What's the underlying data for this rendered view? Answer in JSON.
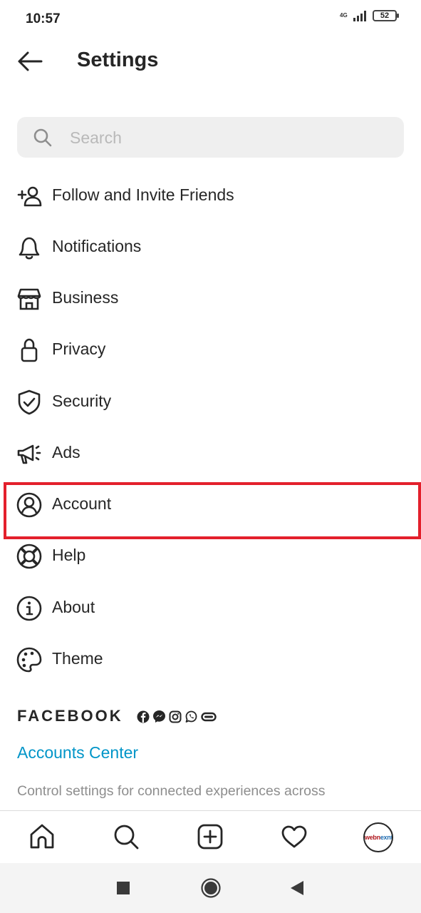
{
  "status_bar": {
    "time": "10:57",
    "network": "4G",
    "battery": "52"
  },
  "header": {
    "title": "Settings",
    "back_icon": "arrow-left-icon"
  },
  "search": {
    "placeholder": "Search",
    "icon": "search-icon"
  },
  "menu": {
    "items": [
      {
        "label": "Follow and Invite Friends",
        "icon": "add-person-icon"
      },
      {
        "label": "Notifications",
        "icon": "bell-icon"
      },
      {
        "label": "Business",
        "icon": "shop-icon"
      },
      {
        "label": "Privacy",
        "icon": "lock-icon"
      },
      {
        "label": "Security",
        "icon": "shield-check-icon"
      },
      {
        "label": "Ads",
        "icon": "megaphone-icon"
      },
      {
        "label": "Account",
        "icon": "person-circle-icon",
        "highlighted": true
      },
      {
        "label": "Help",
        "icon": "lifebuoy-icon"
      },
      {
        "label": "About",
        "icon": "info-icon"
      },
      {
        "label": "Theme",
        "icon": "palette-icon"
      }
    ]
  },
  "facebook": {
    "heading": "FACEBOOK",
    "icons": [
      "facebook-icon",
      "messenger-icon",
      "instagram-icon",
      "whatsapp-icon",
      "portal-icon"
    ],
    "accounts_center": "Accounts Center",
    "description": "Control settings for connected experiences across"
  },
  "bottom_nav": {
    "items": [
      "home-icon",
      "search-icon",
      "new-post-icon",
      "heart-icon"
    ],
    "avatar_text_a": "webn",
    "avatar_text_b": "exnt"
  },
  "android_nav": [
    "recents-square-icon",
    "home-circle-icon",
    "back-triangle-icon"
  ],
  "colors": {
    "text": "#262626",
    "link": "#0095c8",
    "highlight": "#e3202c",
    "search_bg": "#efefef",
    "muted": "#8e8e8e"
  }
}
